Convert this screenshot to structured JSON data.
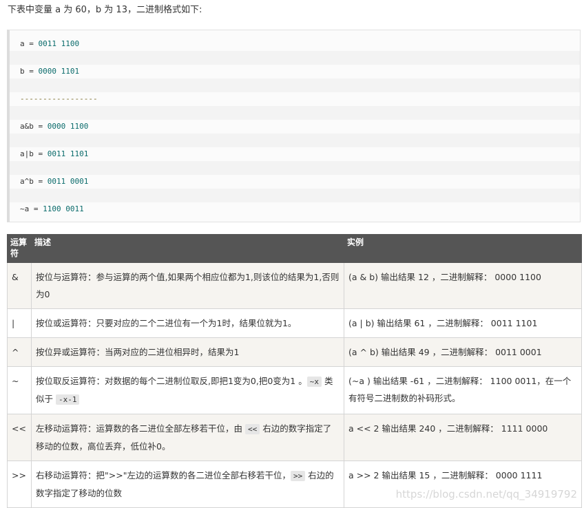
{
  "intro": "下表中变量 a 为 60，b 为 13，二进制格式如下:",
  "code": {
    "lines": [
      {
        "lhs": "a",
        "eq": " = ",
        "rhs": "0011 1100"
      },
      {
        "lhs": "b",
        "eq": " = ",
        "rhs": "0000 1101"
      },
      {
        "lhs": "",
        "eq": "",
        "rhs": "-----------------"
      },
      {
        "lhs": "a&b",
        "eq": " = ",
        "rhs": "0000 1100"
      },
      {
        "lhs": "a|b",
        "eq": " = ",
        "rhs": "0011 1101"
      },
      {
        "lhs": "a^b",
        "eq": " = ",
        "rhs": "0011 0001"
      },
      {
        "lhs": "~a",
        "eq": "  = ",
        "rhs": "1100 0011"
      }
    ]
  },
  "table": {
    "headers": [
      "运算符",
      "描述",
      "实例"
    ],
    "rows": [
      {
        "op": "&",
        "desc": "按位与运算符：参与运算的两个值,如果两个相应位都为1,则该位的结果为1,否则为0",
        "ex": "(a & b) 输出结果 12 ，二进制解释： 0000 1100"
      },
      {
        "op": "|",
        "desc": "按位或运算符：只要对应的二个二进位有一个为1时，结果位就为1。",
        "ex": "(a | b) 输出结果 61 ，二进制解释： 0011 1101"
      },
      {
        "op": "^",
        "desc": "按位异或运算符：当两对应的二进位相异时，结果为1",
        "ex": "(a ^ b) 输出结果 49 ，二进制解释： 0011 0001"
      },
      {
        "op": "~",
        "desc_pre": "按位取反运算符：对数据的每个二进制位取反,即把1变为0,把0变为1 。",
        "desc_code1": "~x",
        "desc_mid": " 类似于 ",
        "desc_code2": "-x-1",
        "ex": "(~a ) 输出结果 -61 ，二进制解释： 1100 0011，在一个有符号二进制数的补码形式。"
      },
      {
        "op": "<<",
        "desc_pre": "左移动运算符：运算数的各二进位全部左移若干位，由 ",
        "desc_code1": "<<",
        "desc_post": " 右边的数字指定了移动的位数，高位丢弃，低位补0。",
        "ex": "a << 2 输出结果 240 ，二进制解释： 1111 0000"
      },
      {
        "op": ">>",
        "desc_pre": "右移动运算符：把\">>\"左边的运算数的各二进位全部右移若干位，",
        "desc_code1": ">>",
        "desc_post": " 右边的数字指定了移动的位数",
        "ex": "a >> 2 输出结果 15 ，二进制解释： 0000 1111"
      }
    ]
  },
  "watermark": "https://blog.csdn.net/qq_34919792"
}
